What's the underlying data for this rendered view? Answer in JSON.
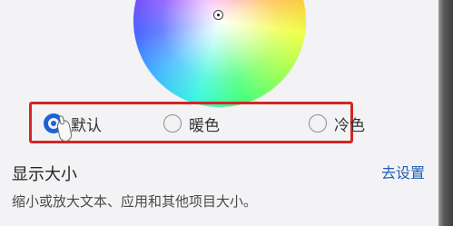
{
  "color_temperature": {
    "options": [
      {
        "label": "默认",
        "selected": true
      },
      {
        "label": "暖色",
        "selected": false
      },
      {
        "label": "冷色",
        "selected": false
      }
    ]
  },
  "display_size": {
    "title": "显示大小",
    "link": "去设置",
    "description": "缩小或放大文本、应用和其他项目大小。"
  },
  "colors": {
    "accent": "#1d63d8",
    "highlight_box": "#d52525",
    "link": "#1f5db7",
    "background": "#f3f3f5"
  }
}
